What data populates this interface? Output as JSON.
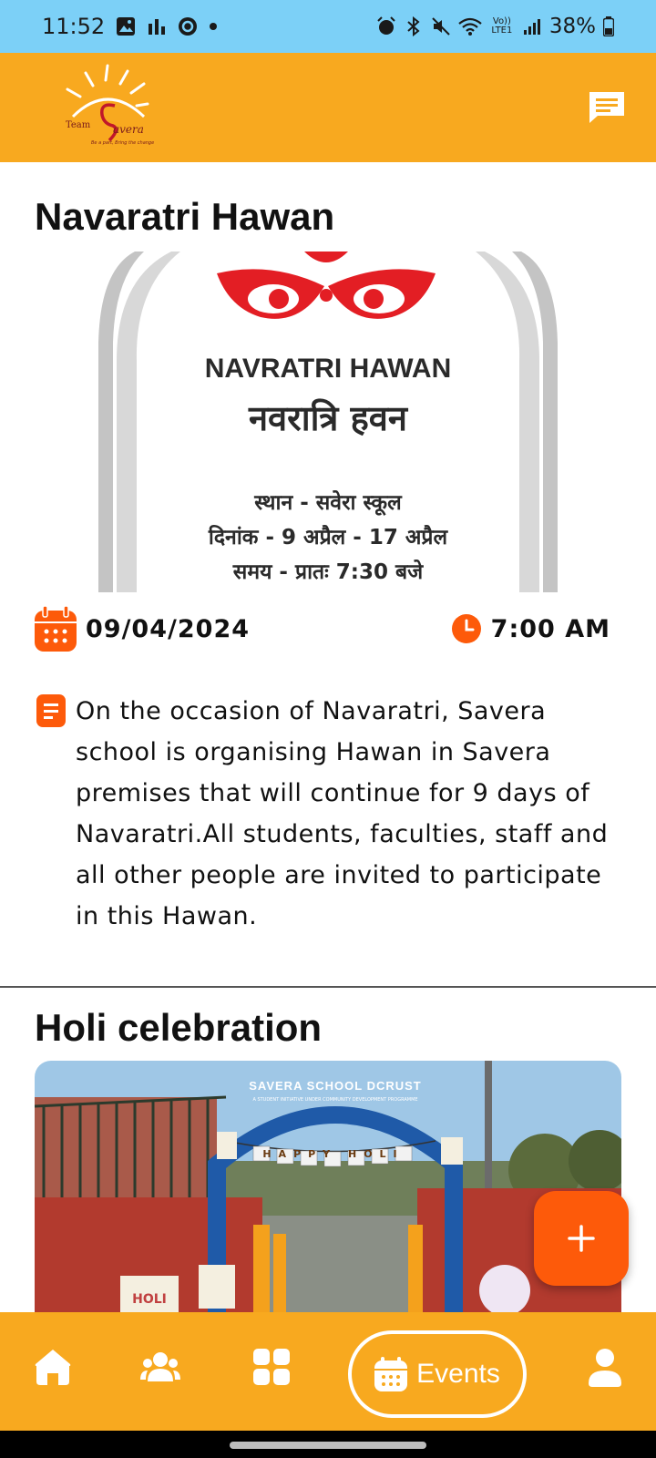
{
  "status_bar": {
    "time": "11:52",
    "battery": "38%",
    "network_label": "Vo)) LTE1"
  },
  "header": {
    "logo_text": "Team Savera",
    "logo_tagline": "Be a part, Bring the change",
    "chat_icon": "chat-icon"
  },
  "events": [
    {
      "title": "Navaratri Hawan",
      "poster": {
        "heading_en": "NAVRATRI HAWAN",
        "heading_hi": "नवरात्रि हवन",
        "line1": "स्थान -  सवेरा स्कूल",
        "line2": "दिनांक - 9 अप्रैल - 17 अप्रैल",
        "line3": "समय - प्रातः 7:30 बजे"
      },
      "date": "09/04/2024",
      "time": "7:00 AM",
      "description": "On the occasion of Navaratri, Savera school is organising Hawan in Savera premises that will continue for 9 days of Navaratri.All students, faculties, staff and all other people are invited to participate in this Hawan."
    },
    {
      "title": "Holi celebration",
      "photo": {
        "arch_text": "SAVERA SCHOOL DCRUST",
        "arch_subtext": "A STUDENT INITIATIVE UNDER COMMUNITY DEVELOPMENT PROGRAMME",
        "banner_text": "HAPPY HOLI",
        "sign_text": "HOLI"
      }
    }
  ],
  "fab": {
    "icon": "plus-icon"
  },
  "bottom_nav": {
    "items": [
      "home-icon",
      "community-icon",
      "dashboard-icon",
      "events-icon",
      "profile-icon"
    ],
    "active_label": "Events"
  },
  "colors": {
    "accent": "#f8a91f",
    "status_bar": "#7cd0f7",
    "icon_orange": "#fd5a0a"
  }
}
